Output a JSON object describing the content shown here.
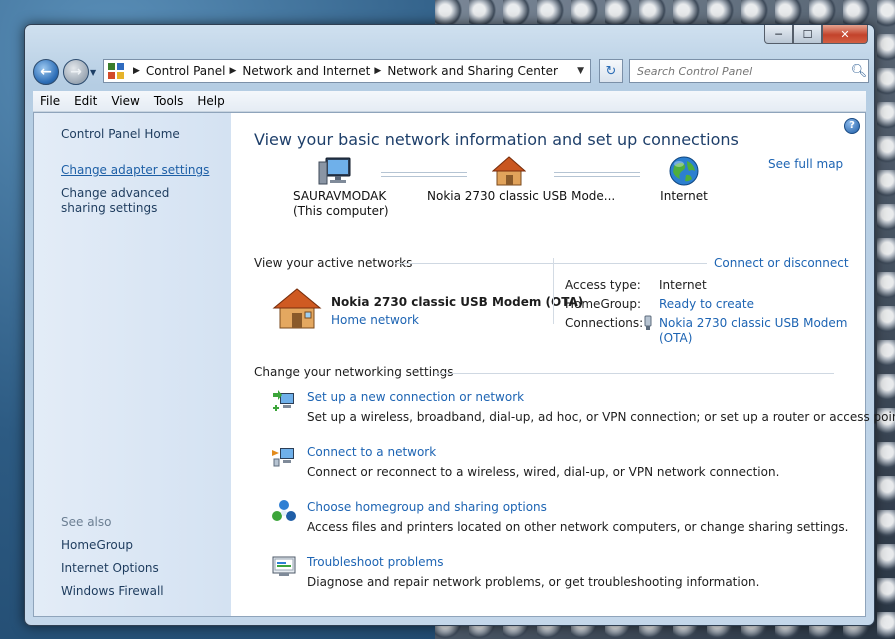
{
  "window": {
    "buttons": {
      "minimize": "─",
      "maximize": "☐",
      "close": "✕"
    }
  },
  "address": {
    "crumbs": [
      "Control Panel",
      "Network and Internet",
      "Network and Sharing Center"
    ],
    "search_placeholder": "Search Control Panel"
  },
  "menu": [
    "File",
    "Edit",
    "View",
    "Tools",
    "Help"
  ],
  "sidebar": {
    "home": "Control Panel Home",
    "links": [
      "Change adapter settings",
      "Change advanced sharing settings"
    ],
    "see_also_title": "See also",
    "see_also": [
      "HomeGroup",
      "Internet Options",
      "Windows Firewall"
    ]
  },
  "main": {
    "heading": "View your basic network information and set up connections",
    "see_full_map": "See full map",
    "map": {
      "computer": {
        "name": "SAURAVMODAK",
        "sub": "(This computer)"
      },
      "network": {
        "name": "Nokia 2730 classic USB Mode..."
      },
      "internet": {
        "name": "Internet"
      }
    },
    "active_title": "View your active networks",
    "connect_disconnect": "Connect or disconnect",
    "active_network": {
      "name": "Nokia 2730 classic USB Modem (OTA)",
      "type": "Home network",
      "access_type_label": "Access type:",
      "access_type_value": "Internet",
      "homegroup_label": "HomeGroup:",
      "homegroup_value": "Ready to create",
      "connections_label": "Connections:",
      "connections_value_1": "Nokia 2730 classic USB Modem",
      "connections_value_2": "(OTA)"
    },
    "settings_title": "Change your networking settings",
    "tasks": [
      {
        "title": "Set up a new connection or network",
        "desc": "Set up a wireless, broadband, dial-up, ad hoc, or VPN connection; or set up a router or access point."
      },
      {
        "title": "Connect to a network",
        "desc": "Connect or reconnect to a wireless, wired, dial-up, or VPN network connection."
      },
      {
        "title": "Choose homegroup and sharing options",
        "desc": "Access files and printers located on other network computers, or change sharing settings."
      },
      {
        "title": "Troubleshoot problems",
        "desc": "Diagnose and repair network problems, or get troubleshooting information."
      }
    ],
    "help": "?"
  }
}
